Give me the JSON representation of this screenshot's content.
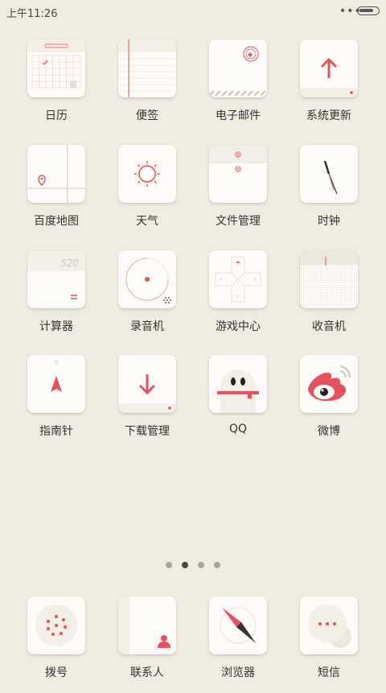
{
  "status_bar": {
    "time": "上午11:26",
    "more": "•••",
    "battery_level": 0.8
  },
  "apps": [
    {
      "label": "日历",
      "icon": "calendar-icon"
    },
    {
      "label": "便签",
      "icon": "notes-icon"
    },
    {
      "label": "电子邮件",
      "icon": "email-icon"
    },
    {
      "label": "系统更新",
      "icon": "update-icon"
    },
    {
      "label": "百度地图",
      "icon": "map-icon"
    },
    {
      "label": "天气",
      "icon": "weather-icon"
    },
    {
      "label": "文件管理",
      "icon": "file-manager-icon"
    },
    {
      "label": "时钟",
      "icon": "clock-icon"
    },
    {
      "label": "计算器",
      "icon": "calculator-icon",
      "display": "520"
    },
    {
      "label": "录音机",
      "icon": "recorder-icon"
    },
    {
      "label": "游戏中心",
      "icon": "game-center-icon"
    },
    {
      "label": "收音机",
      "icon": "radio-icon"
    },
    {
      "label": "指南针",
      "icon": "compass-icon"
    },
    {
      "label": "下载管理",
      "icon": "download-icon"
    },
    {
      "label": "QQ",
      "icon": "qq-icon"
    },
    {
      "label": "微博",
      "icon": "weibo-icon"
    }
  ],
  "dock": [
    {
      "label": "拨号",
      "icon": "dialer-icon"
    },
    {
      "label": "联系人",
      "icon": "contacts-icon"
    },
    {
      "label": "浏览器",
      "icon": "browser-icon"
    },
    {
      "label": "短信",
      "icon": "messages-icon"
    }
  ],
  "pager": {
    "count": 4,
    "active_index": 1
  },
  "colors": {
    "background": "#efebe0",
    "tile": "#fdfcf8",
    "accent": "#e8505b",
    "label": "#333333"
  }
}
